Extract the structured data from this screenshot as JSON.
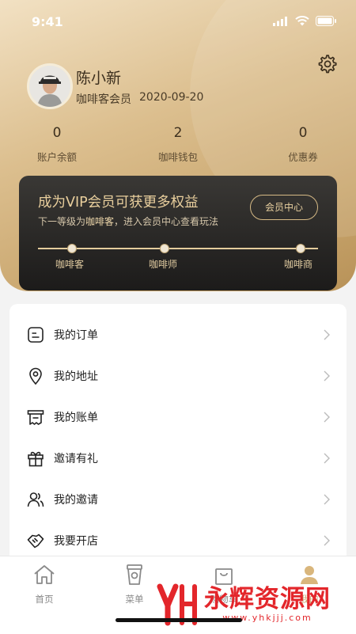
{
  "status": {
    "time": "9:41"
  },
  "profile": {
    "name": "陈小新",
    "level": "咖啡客会员",
    "date": "2020-09-20"
  },
  "stats": [
    {
      "value": "0",
      "label": "账户余额"
    },
    {
      "value": "2",
      "label": "咖啡钱包"
    },
    {
      "value": "0",
      "label": "优惠券"
    }
  ],
  "vip": {
    "title": "成为VIP会员可获更多权益",
    "sub_prefix": "下一等级为",
    "sub_level": "咖啡客",
    "sub_suffix": "，进入会员中心查看玩法",
    "button": "会员中心",
    "levels": [
      "咖啡客",
      "咖啡师",
      "咖啡商"
    ]
  },
  "menu": {
    "items": [
      {
        "label": "我的订单",
        "icon": "order-icon"
      },
      {
        "label": "我的地址",
        "icon": "location-icon"
      },
      {
        "label": "我的账单",
        "icon": "bill-icon"
      },
      {
        "label": "邀请有礼",
        "icon": "gift-icon"
      },
      {
        "label": "我的邀请",
        "icon": "invite-icon"
      },
      {
        "label": "我要开店",
        "icon": "handshake-icon"
      }
    ]
  },
  "tabbar": {
    "items": [
      {
        "label": "首页",
        "icon": "home-icon"
      },
      {
        "label": "菜单",
        "icon": "cup-icon"
      },
      {
        "label": "购物车",
        "icon": "bag-icon"
      },
      {
        "label": "我的",
        "icon": "user-icon",
        "active": true
      }
    ]
  },
  "watermark": {
    "text": "永辉资源网",
    "url": "www.yhkjjj.com"
  },
  "colors": {
    "gold": "#c9a66e",
    "dark": "#1c1b1a",
    "accent_text": "#e9cf9d",
    "watermark": "#e3262b"
  }
}
